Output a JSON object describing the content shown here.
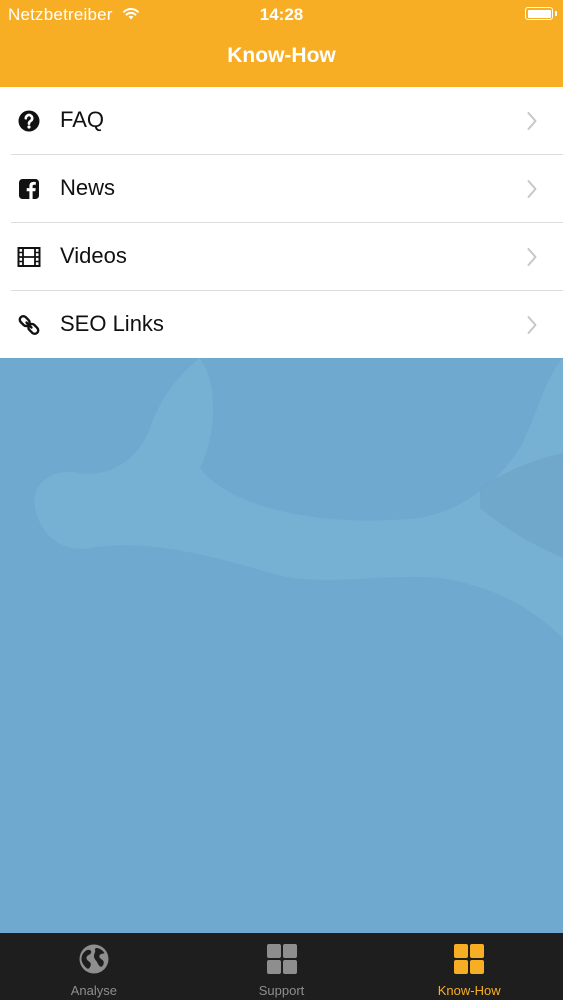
{
  "status_bar": {
    "carrier": "Netzbetreiber",
    "time": "14:28"
  },
  "nav": {
    "title": "Know-How"
  },
  "menu": [
    {
      "label": "FAQ",
      "icon": "question-circle-icon"
    },
    {
      "label": "News",
      "icon": "facebook-square-icon"
    },
    {
      "label": "Videos",
      "icon": "film-icon"
    },
    {
      "label": "SEO Links",
      "icon": "link-icon"
    }
  ],
  "tabs": [
    {
      "label": "Analyse",
      "icon": "globe-icon",
      "active": false
    },
    {
      "label": "Support",
      "icon": "grid-icon",
      "active": false
    },
    {
      "label": "Know-How",
      "icon": "grid-icon",
      "active": true
    }
  ],
  "colors": {
    "accent": "#f8ae24",
    "background": "#70a9d0",
    "tabbar": "#1e1e1e",
    "inactive_tab": "#8e8e8e"
  }
}
